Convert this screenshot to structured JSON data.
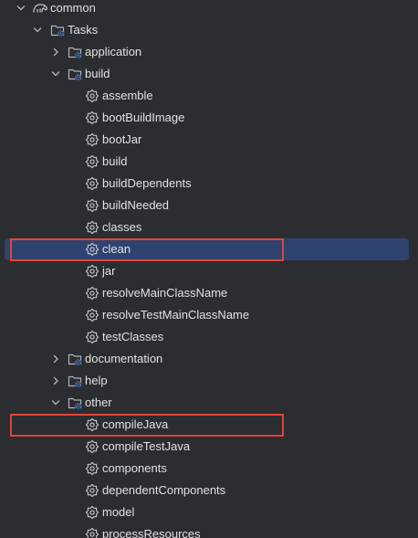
{
  "tree": {
    "root": {
      "label": "common",
      "icon": "gradle-elephant-icon",
      "expanded": true
    },
    "tasks": {
      "label": "Tasks",
      "icon": "folder-gear-icon",
      "expanded": true
    },
    "groups": [
      {
        "label": "application",
        "expanded": false
      },
      {
        "label": "build",
        "expanded": true,
        "tasks": [
          "assemble",
          "bootBuildImage",
          "bootJar",
          "build",
          "buildDependents",
          "buildNeeded",
          "classes",
          "clean",
          "jar",
          "resolveMainClassName",
          "resolveTestMainClassName",
          "testClasses"
        ]
      },
      {
        "label": "documentation",
        "expanded": false
      },
      {
        "label": "help",
        "expanded": false
      },
      {
        "label": "other",
        "expanded": true,
        "tasks": [
          "compileJava",
          "compileTestJava",
          "components",
          "dependentComponents",
          "model",
          "processResources"
        ]
      }
    ],
    "selected_task": "clean",
    "highlighted_tasks": [
      "clean",
      "compileJava"
    ]
  },
  "colors": {
    "background": "#2b2d30",
    "text": "#dfe1e5",
    "selection": "#2e436e",
    "highlight_border": "#e0453a",
    "folder_icon": "#aeb3bb",
    "gear_badge": "#4f8ff7"
  }
}
